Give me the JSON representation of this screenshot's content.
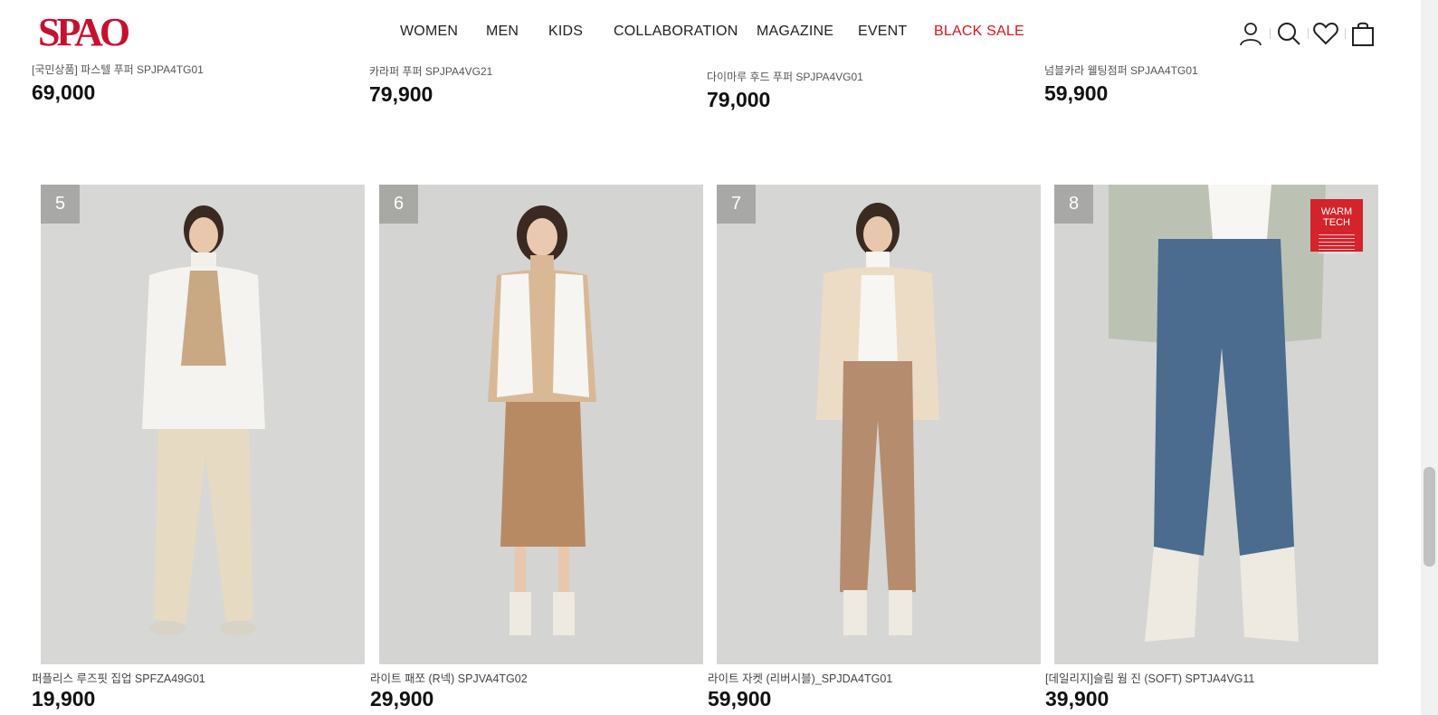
{
  "brand": {
    "logo_text": "SPAO",
    "accent": "#e3131c",
    "logo_color": "#c8102e"
  },
  "nav": {
    "items": [
      "WOMEN",
      "MEN",
      "KIDS",
      "COLLABORATION",
      "MAGAZINE",
      "EVENT",
      "BLACK SALE"
    ]
  },
  "utilities": [
    "user-icon",
    "search-icon",
    "heart-icon",
    "shopping-bag-icon"
  ],
  "previous_row": [
    {
      "name": "[국민상품] 파스텔 푸퍼 SPJPA4TG01",
      "price": "69,000"
    },
    {
      "name": "카라퍼 푸퍼 SPJPA4VG21",
      "price": "79,900"
    },
    {
      "name": "다이마루 후드 푸퍼 SPJPA4VG01",
      "price": "79,000"
    },
    {
      "name": "넘블카라 웰팅점퍼 SPJAA4TG01",
      "price": "59,900"
    }
  ],
  "products": [
    {
      "rank": "5",
      "name": "퍼플리스 루즈핏 집업 SPFZA49G01",
      "price": "19,900"
    },
    {
      "rank": "6",
      "name": "라이트 패쪼 (R넥) SPJVA4TG02",
      "price": "29,900"
    },
    {
      "rank": "7",
      "name": "라이트 자켓 (리버시블)_SPJDA4TG01",
      "price": "59,900"
    },
    {
      "rank": "8",
      "name": "[데일리지]슬림 웜 진 (SOFT) SPTJA4VG11",
      "price": "39,900",
      "badge": [
        "WARM",
        "TECH"
      ]
    }
  ]
}
